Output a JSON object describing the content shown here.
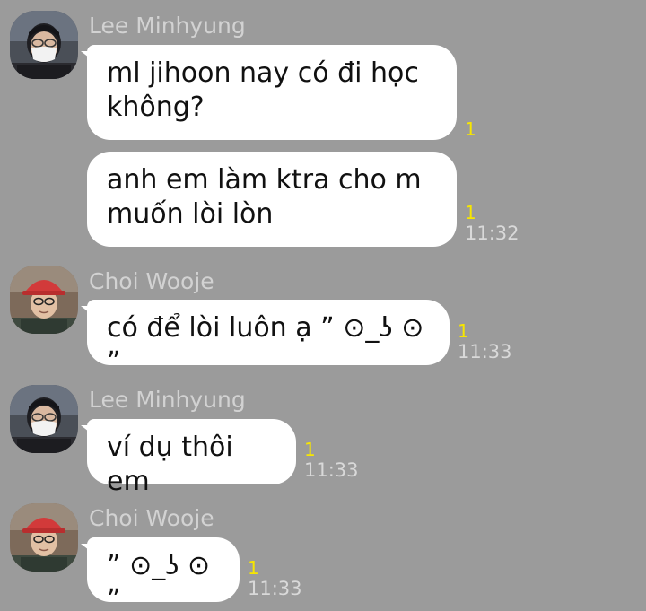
{
  "conversation": {
    "groups": [
      {
        "sender": "Lee Minhyung",
        "avatar": "avatar-lee-minhyung",
        "messages": [
          {
            "text": "ml jihoon nay có đi học không?",
            "unread": "1",
            "time": ""
          },
          {
            "text": "anh em làm ktra cho m muốn lòi lòn",
            "unread": "1",
            "time": "11:32"
          }
        ]
      },
      {
        "sender": "Choi Wooje",
        "avatar": "avatar-choi-wooje",
        "messages": [
          {
            "text": "có để lòi luôn ạ ” ⊙_ʖ ⊙ ”",
            "unread": "1",
            "time": "11:33"
          }
        ]
      },
      {
        "sender": "Lee Minhyung",
        "avatar": "avatar-lee-minhyung",
        "messages": [
          {
            "text": "ví dụ thôi em",
            "unread": "1",
            "time": "11:33"
          }
        ]
      },
      {
        "sender": "Choi Wooje",
        "avatar": "avatar-choi-wooje",
        "messages": [
          {
            "text": "” ⊙_ʖ ⊙ ”",
            "unread": "1",
            "time": "11:33"
          }
        ]
      }
    ]
  },
  "colors": {
    "background": "#9b9b9b",
    "bubble": "#ffffff",
    "unread": "#f7e600",
    "sender": "#d2d2d2",
    "time": "#d9d9d9"
  }
}
